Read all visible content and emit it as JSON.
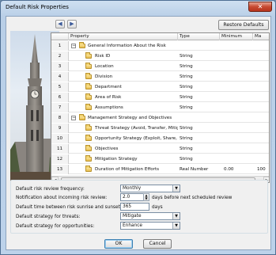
{
  "window": {
    "title": "Default Risk Properties",
    "close_glyph": "✕"
  },
  "toolbar": {
    "back_glyph": "◀",
    "forward_glyph": "▶",
    "restore_label": "Restore Defaults"
  },
  "grid": {
    "columns": [
      "Property",
      "Type",
      "Minimum",
      "Ma"
    ],
    "rows": [
      {
        "num": "1",
        "kind": "group",
        "label": "General Information About the Risk",
        "type": "",
        "min": "",
        "max": ""
      },
      {
        "num": "2",
        "kind": "child",
        "label": "Risk ID",
        "type": "String",
        "min": "",
        "max": ""
      },
      {
        "num": "3",
        "kind": "child",
        "label": "Location",
        "type": "String",
        "min": "",
        "max": ""
      },
      {
        "num": "4",
        "kind": "child",
        "label": "Division",
        "type": "String",
        "min": "",
        "max": ""
      },
      {
        "num": "5",
        "kind": "child",
        "label": "Department",
        "type": "String",
        "min": "",
        "max": ""
      },
      {
        "num": "6",
        "kind": "child",
        "label": "Area of Risk",
        "type": "String",
        "min": "",
        "max": ""
      },
      {
        "num": "7",
        "kind": "child",
        "label": "Assumptions",
        "type": "String",
        "min": "",
        "max": ""
      },
      {
        "num": "8",
        "kind": "group",
        "label": "Management Strategy and Objectives",
        "type": "",
        "min": "",
        "max": ""
      },
      {
        "num": "9",
        "kind": "child",
        "label": "Threat Strategy (Avoid, Transfer, Mitiga",
        "type": "String",
        "min": "",
        "max": ""
      },
      {
        "num": "10",
        "kind": "child",
        "label": "Opportunity Strategy (Exploit, Share, En",
        "type": "String",
        "min": "",
        "max": ""
      },
      {
        "num": "11",
        "kind": "child",
        "label": "Objectives",
        "type": "String",
        "min": "",
        "max": ""
      },
      {
        "num": "12",
        "kind": "child",
        "label": "Mitigation Strategy",
        "type": "String",
        "min": "",
        "max": ""
      },
      {
        "num": "13",
        "kind": "child",
        "label": "Duration of Mitigation Efforts",
        "type": "Real Number",
        "min": "0.00",
        "max": "100"
      }
    ],
    "scroll_left_glyph": "◀",
    "scroll_right_glyph": "▶"
  },
  "settings": {
    "review_frequency_label": "Default risk review frequency:",
    "review_frequency_value": "Monthly",
    "notification_label": "Notification about incoming risk review:",
    "notification_value": "2.0",
    "notification_suffix": "days before next scheduled review",
    "sunrise_label": "Default time between risk sunrise and sunset:",
    "sunrise_value": "365",
    "sunrise_suffix": "days",
    "threats_label": "Default strategy for threats:",
    "threats_value": "Mitigate",
    "opportunities_label": "Default strategy for opportunities:",
    "opportunities_value": "Enhance",
    "dropdown_glyph": "▼",
    "spin_up_glyph": "▲",
    "spin_down_glyph": "▼"
  },
  "buttons": {
    "ok_label": "OK",
    "cancel_label": "Cancel"
  }
}
